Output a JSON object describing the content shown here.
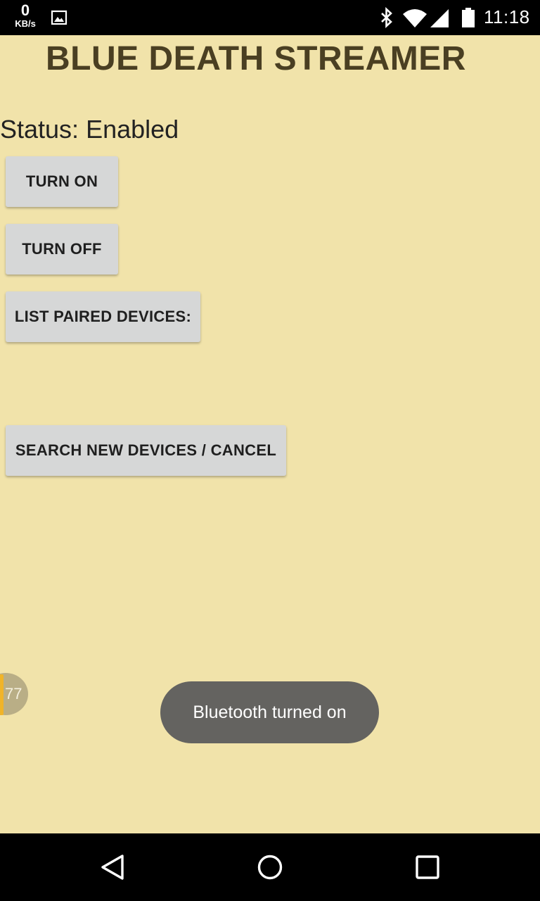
{
  "status_bar": {
    "speed_value": "0",
    "speed_unit": "KB/s",
    "time": "11:18",
    "icons": [
      "image-notification-icon",
      "bluetooth-icon",
      "wifi-icon",
      "cell-signal-icon",
      "battery-icon"
    ]
  },
  "app": {
    "title": "BLUE DEATH STREAMER",
    "status": "Status: Enabled",
    "buttons": {
      "turn_on": "TURN ON",
      "turn_off": "TURN OFF",
      "list_paired": "LIST PAIRED DEVICES:",
      "search": "SEARCH NEW DEVICES / CANCEL"
    }
  },
  "floating_bubble": {
    "label": "77"
  },
  "toast": {
    "message": "Bluetooth turned on"
  },
  "nav_bar": {
    "icons": [
      "back-icon",
      "home-icon",
      "recents-icon"
    ]
  },
  "colors": {
    "background": "#f1e3aa",
    "title": "#4a3f22",
    "button": "#d6d7d7",
    "toast": "#646360"
  }
}
